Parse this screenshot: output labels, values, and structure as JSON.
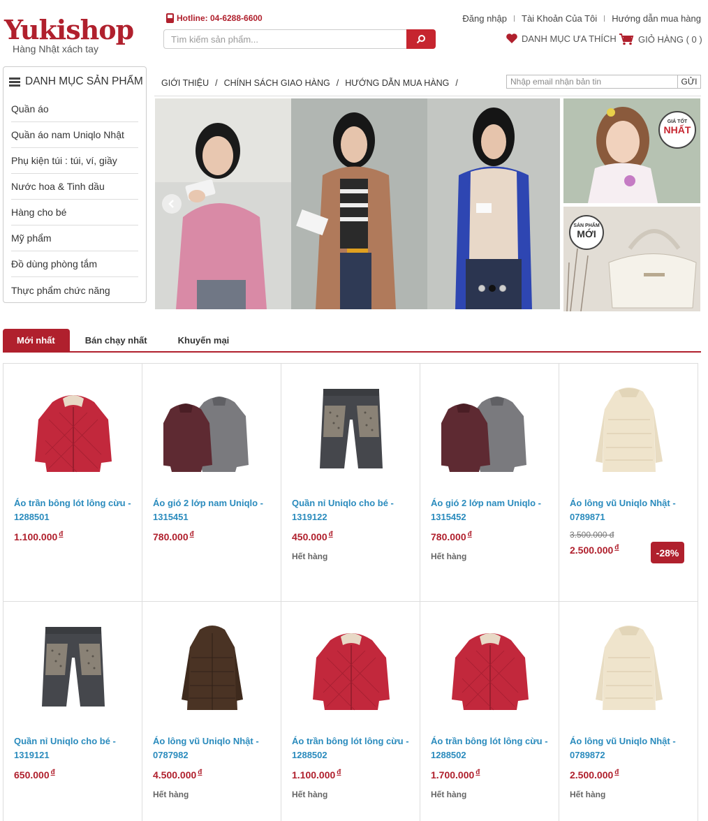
{
  "brand": {
    "logo_text": "Yukishop",
    "tagline": "Hàng Nhật xách tay",
    "hotline": "Hotline: 04-6288-6600"
  },
  "search": {
    "placeholder": "Tìm kiếm sản phẩm..."
  },
  "toplinks": {
    "login": "Đăng nhập",
    "account": "Tài Khoản Của Tôi",
    "guide": "Hướng dẫn mua hàng"
  },
  "wishlist_label": "DANH MỤC ƯA THÍCH",
  "cart_label": "GIỎ HÀNG ( 0 )",
  "category": {
    "title": "DANH MỤC SẢN PHẨM",
    "items": [
      "Quần áo",
      "Quần áo nam Uniqlo Nhật",
      "Phụ kiện túi : túi, ví, giầy",
      "Nước hoa & Tinh dầu",
      "Hàng cho bé",
      "Mỹ phẩm",
      "Đồ dùng phòng tắm",
      "Thực phẩm chức năng"
    ]
  },
  "nav": {
    "items": [
      "GIỚI THIỆU",
      "CHÍNH SÁCH GIAO HÀNG",
      "HƯỚNG DẪN MUA HÀNG"
    ],
    "separator": "/"
  },
  "newsletter": {
    "placeholder": "Nhập email nhận bản tin",
    "button": "GỬI"
  },
  "promo": {
    "best_price_small": "GIÁ TỐT",
    "best_price_big": "NHẤT",
    "new_small": "SẢN PHẨM",
    "new_big": "MỚI"
  },
  "tabs": [
    "Mới nhất",
    "Bán chạy nhất",
    "Khuyến mại"
  ],
  "currency": "đ",
  "products": [
    {
      "name": "Áo trần bông lót lông cừu - 1288501",
      "price": "1.100.000",
      "stock": "",
      "old_price": "",
      "discount": "",
      "img": "red-jacket"
    },
    {
      "name": "Áo gió 2 lớp nam Uniqlo - 1315451",
      "price": "780.000",
      "stock": "",
      "old_price": "",
      "discount": "",
      "img": "two-jackets"
    },
    {
      "name": "Quần nỉ Uniqlo cho bé - 1319122",
      "price": "450.000",
      "stock": "Hết hàng",
      "old_price": "",
      "discount": "",
      "img": "pants"
    },
    {
      "name": "Áo gió 2 lớp nam Uniqlo - 1315452",
      "price": "780.000",
      "stock": "Hết hàng",
      "old_price": "",
      "discount": "",
      "img": "two-jackets"
    },
    {
      "name": "Áo lông vũ Uniqlo Nhật - 0789871",
      "price": "2.500.000",
      "stock": "",
      "old_price": "3.500.000 đ",
      "discount": "-28%",
      "img": "cream-coat"
    },
    {
      "name": "Quần nỉ Uniqlo cho bé - 1319121",
      "price": "650.000",
      "stock": "",
      "old_price": "",
      "discount": "",
      "img": "pants"
    },
    {
      "name": "Áo lông vũ Uniqlo Nhật - 0787982",
      "price": "4.500.000",
      "stock": "Hết hàng",
      "old_price": "",
      "discount": "",
      "img": "brown-coat"
    },
    {
      "name": "Áo trần bông lót lông cừu - 1288502",
      "price": "1.100.000",
      "stock": "Hết hàng",
      "old_price": "",
      "discount": "",
      "img": "red-jacket"
    },
    {
      "name": "Áo trần bông lót lông cừu - 1288502",
      "price": "1.700.000",
      "stock": "Hết hàng",
      "old_price": "",
      "discount": "",
      "img": "red-jacket"
    },
    {
      "name": "Áo lông vũ Uniqlo Nhật - 0789872",
      "price": "2.500.000",
      "stock": "Hết hàng",
      "old_price": "",
      "discount": "",
      "img": "cream-coat"
    }
  ],
  "colors": {
    "brand_red": "#b0202d",
    "link_blue": "#2a8bbd"
  }
}
